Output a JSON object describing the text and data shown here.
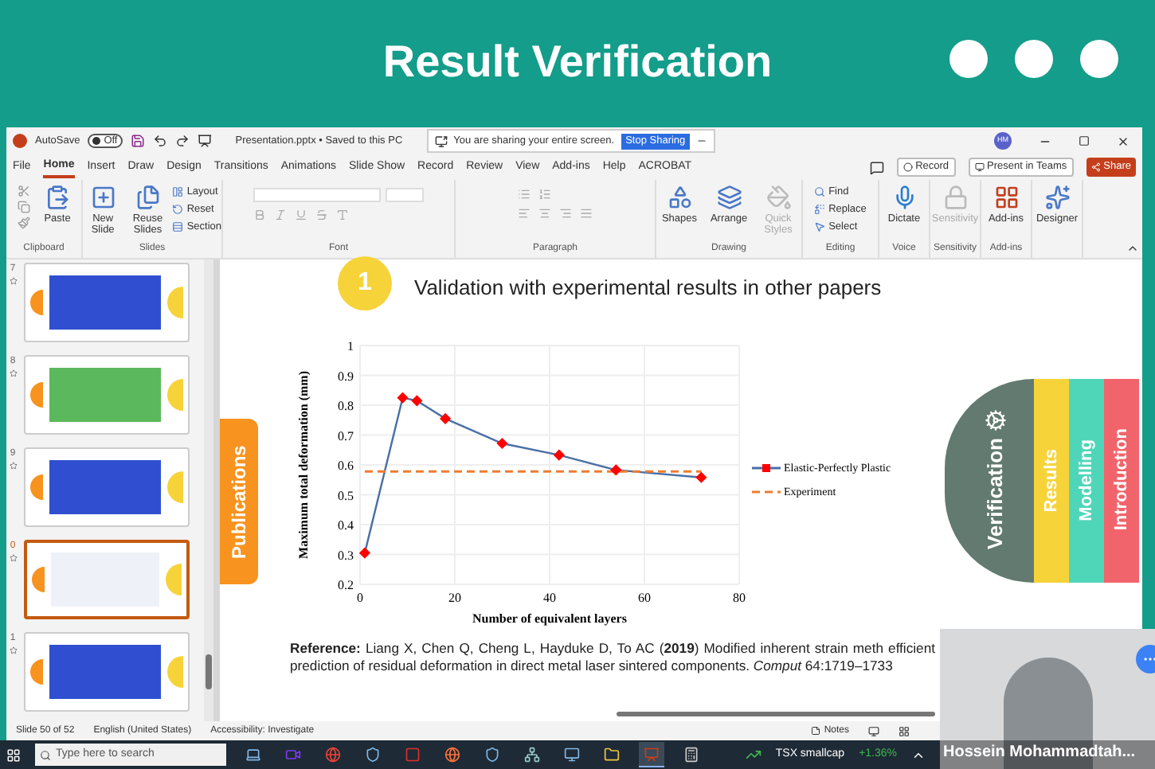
{
  "header": {
    "title": "Result Verification"
  },
  "titlebar": {
    "autosave_label": "AutoSave",
    "autosave": {
      "label": "Off",
      "on": false
    },
    "document": "Presentation.pptx • Saved to this PC",
    "sharing": {
      "message": "You are sharing your entire screen.",
      "button": "Stop Sharing"
    },
    "avatar": "HM"
  },
  "menu": {
    "tabs": [
      {
        "label": "File",
        "selected": false
      },
      {
        "label": "Home",
        "selected": true
      },
      {
        "label": "Insert",
        "selected": false
      },
      {
        "label": "Draw",
        "selected": false
      },
      {
        "label": "Design",
        "selected": false
      },
      {
        "label": "Transitions",
        "selected": false
      },
      {
        "label": "Animations",
        "selected": false
      },
      {
        "label": "Slide Show",
        "selected": false
      },
      {
        "label": "Record",
        "selected": false
      },
      {
        "label": "Review",
        "selected": false
      },
      {
        "label": "View",
        "selected": false
      },
      {
        "label": "Add-ins",
        "selected": false
      },
      {
        "label": "Help",
        "selected": false
      },
      {
        "label": "ACROBAT",
        "selected": false
      }
    ],
    "actions": [
      {
        "label": "Record",
        "kind": "outline"
      },
      {
        "label": "Present in Teams",
        "kind": "outline"
      },
      {
        "label": "Share",
        "kind": "primary"
      }
    ]
  },
  "ribbon": {
    "groups": [
      {
        "name": "Clipboard",
        "buttons": [
          {
            "label": "Paste",
            "disabled": false
          }
        ]
      },
      {
        "name": "Slides",
        "buttons": [
          {
            "label": "New Slide",
            "disabled": false
          },
          {
            "label": "Reuse Slides",
            "disabled": false
          },
          {
            "label": "Layout",
            "disabled": false
          },
          {
            "label": "Reset",
            "disabled": false
          },
          {
            "label": "Section",
            "disabled": false
          }
        ]
      },
      {
        "name": "Font"
      },
      {
        "name": "Paragraph"
      },
      {
        "name": "Drawing",
        "buttons": [
          {
            "label": "Shapes",
            "disabled": false
          },
          {
            "label": "Arrange",
            "disabled": false
          },
          {
            "label": "Quick Styles",
            "disabled": true
          }
        ]
      },
      {
        "name": "Editing",
        "buttons": [
          {
            "label": "Find",
            "disabled": false
          },
          {
            "label": "Replace",
            "disabled": false
          },
          {
            "label": "Select",
            "disabled": false
          }
        ]
      },
      {
        "name": "Voice",
        "buttons": [
          {
            "label": "Dictate",
            "disabled": false
          }
        ]
      },
      {
        "name": "Sensitivity",
        "buttons": [
          {
            "label": "Sensitivity",
            "disabled": true
          }
        ]
      },
      {
        "name": "Add-ins",
        "buttons": [
          {
            "label": "Add-ins",
            "disabled": false
          }
        ]
      },
      {
        "buttons": [
          {
            "label": "Designer",
            "disabled": false
          }
        ]
      }
    ]
  },
  "thumbnails": [
    {
      "number": "7",
      "selected": false
    },
    {
      "number": "8",
      "selected": false
    },
    {
      "number": "9",
      "selected": false
    },
    {
      "number": "0",
      "selected": true
    },
    {
      "number": "1",
      "selected": false
    }
  ],
  "slide": {
    "side_tab": "Publications",
    "step": "1",
    "heading": "Validation with experimental results in other papers",
    "chart_data": {
      "type": "line",
      "xlabel": "Number of equivalent layers",
      "ylabel": "Maximum total deformation (mm)",
      "x": [
        1,
        9,
        12,
        18,
        30,
        42,
        54,
        72
      ],
      "series": [
        {
          "name": "Elastic-Perfectly Plastic",
          "color": "#4a6fa5",
          "marker": "diamond",
          "line_style": "solid",
          "values": [
            0.305,
            0.825,
            0.815,
            0.755,
            0.672,
            0.633,
            0.583,
            0.558
          ]
        },
        {
          "name": "Experiment",
          "color": "#ed7d31",
          "marker": "none",
          "line_style": "dashed",
          "values": [
            0.578,
            0.578,
            0.578,
            0.578,
            0.578,
            0.578,
            0.578,
            0.578
          ]
        }
      ],
      "grid": true,
      "legend": true,
      "xlim": [
        0,
        80
      ],
      "ylim": [
        0.2,
        1
      ],
      "xticks": [
        0,
        20,
        40,
        60,
        80
      ],
      "yticks": [
        {
          "value": 0.2,
          "label": "0.2"
        },
        {
          "value": 0.3,
          "label": "0.3"
        },
        {
          "value": 0.4,
          "label": "0.4"
        },
        {
          "value": 0.5,
          "label": "0.5"
        },
        {
          "value": 0.6,
          "label": "0.6"
        },
        {
          "value": 0.7,
          "label": "0.7"
        },
        {
          "value": 0.8,
          "label": "0.8"
        },
        {
          "value": 0.9,
          "label": "0.9"
        },
        {
          "value": 1,
          "label": "1"
        }
      ]
    },
    "nav_tabs": [
      {
        "label": "Verification",
        "color": "#627a70",
        "selected": true
      },
      {
        "label": "Results",
        "color": "#f7d33a",
        "selected": false
      },
      {
        "label": "Modelling",
        "color": "#4fd6b8",
        "selected": false
      },
      {
        "label": "Introduction",
        "color": "#f2646b",
        "selected": false
      }
    ],
    "reference": "**Reference:** Liang X, Chen Q, Cheng L, Hayduke D, To AC (**2019**) Modified inherent strain meth efficient prediction of residual deformation in direct metal laser sintered components. *Comput* 64:1719–1733"
  },
  "status_bar": {
    "slide": "Slide 50 of 52",
    "language": "English (United States)",
    "accessibility": "Accessibility: Investigate",
    "notes": "Notes"
  },
  "taskbar": {
    "search_placeholder": "Type here to search",
    "apps": [
      {
        "selected": false
      },
      {
        "selected": false
      },
      {
        "selected": false
      },
      {
        "selected": false
      },
      {
        "selected": false
      },
      {
        "selected": false
      },
      {
        "selected": false
      },
      {
        "selected": false
      },
      {
        "selected": false
      },
      {
        "selected": false
      },
      {
        "selected": true
      },
      {
        "selected": false
      }
    ],
    "ticker": "TSX smallcap",
    "change": "+1.36%"
  },
  "webcam": {
    "name": "Hossein Mohammadtah..."
  }
}
